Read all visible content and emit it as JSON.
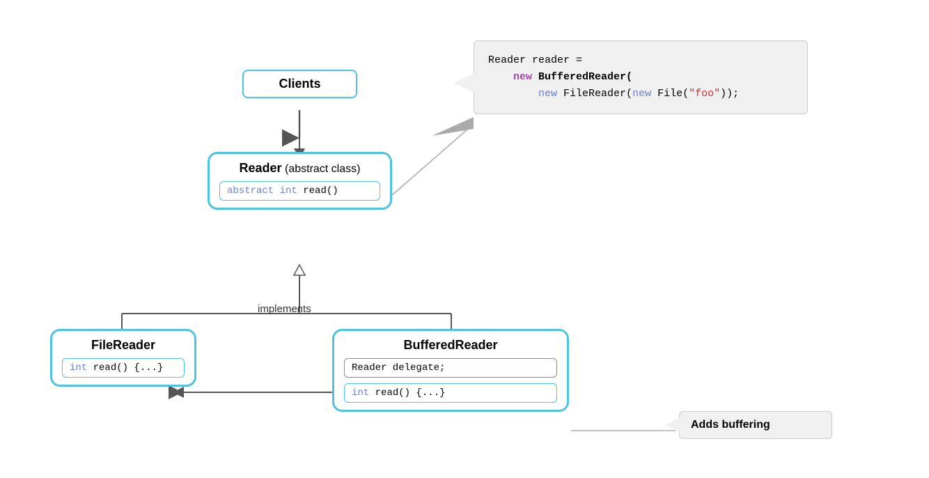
{
  "clients": {
    "label": "Clients"
  },
  "reader": {
    "title": "Reader",
    "subtitle": " (abstract class)",
    "method": "abstract int read()"
  },
  "fileReader": {
    "title": "FileReader",
    "method": "int read() {...}"
  },
  "bufferedReader": {
    "title": "BufferedReader",
    "field": "Reader delegate;",
    "method": "int read() {...}"
  },
  "implements_label": "implements",
  "code": {
    "line1": "Reader reader =",
    "line2_pre": "    ",
    "line2_keyword": "new",
    "line2_class": " BufferedReader(",
    "line3_pre": "        ",
    "line3_keyword": "new",
    "line3_class": " FileReader(",
    "line3_keyword2": "new",
    "line3_class2": " File(",
    "line3_string": "\"foo\"",
    "line3_end": "));"
  },
  "callout": {
    "label": "Adds buffering"
  }
}
